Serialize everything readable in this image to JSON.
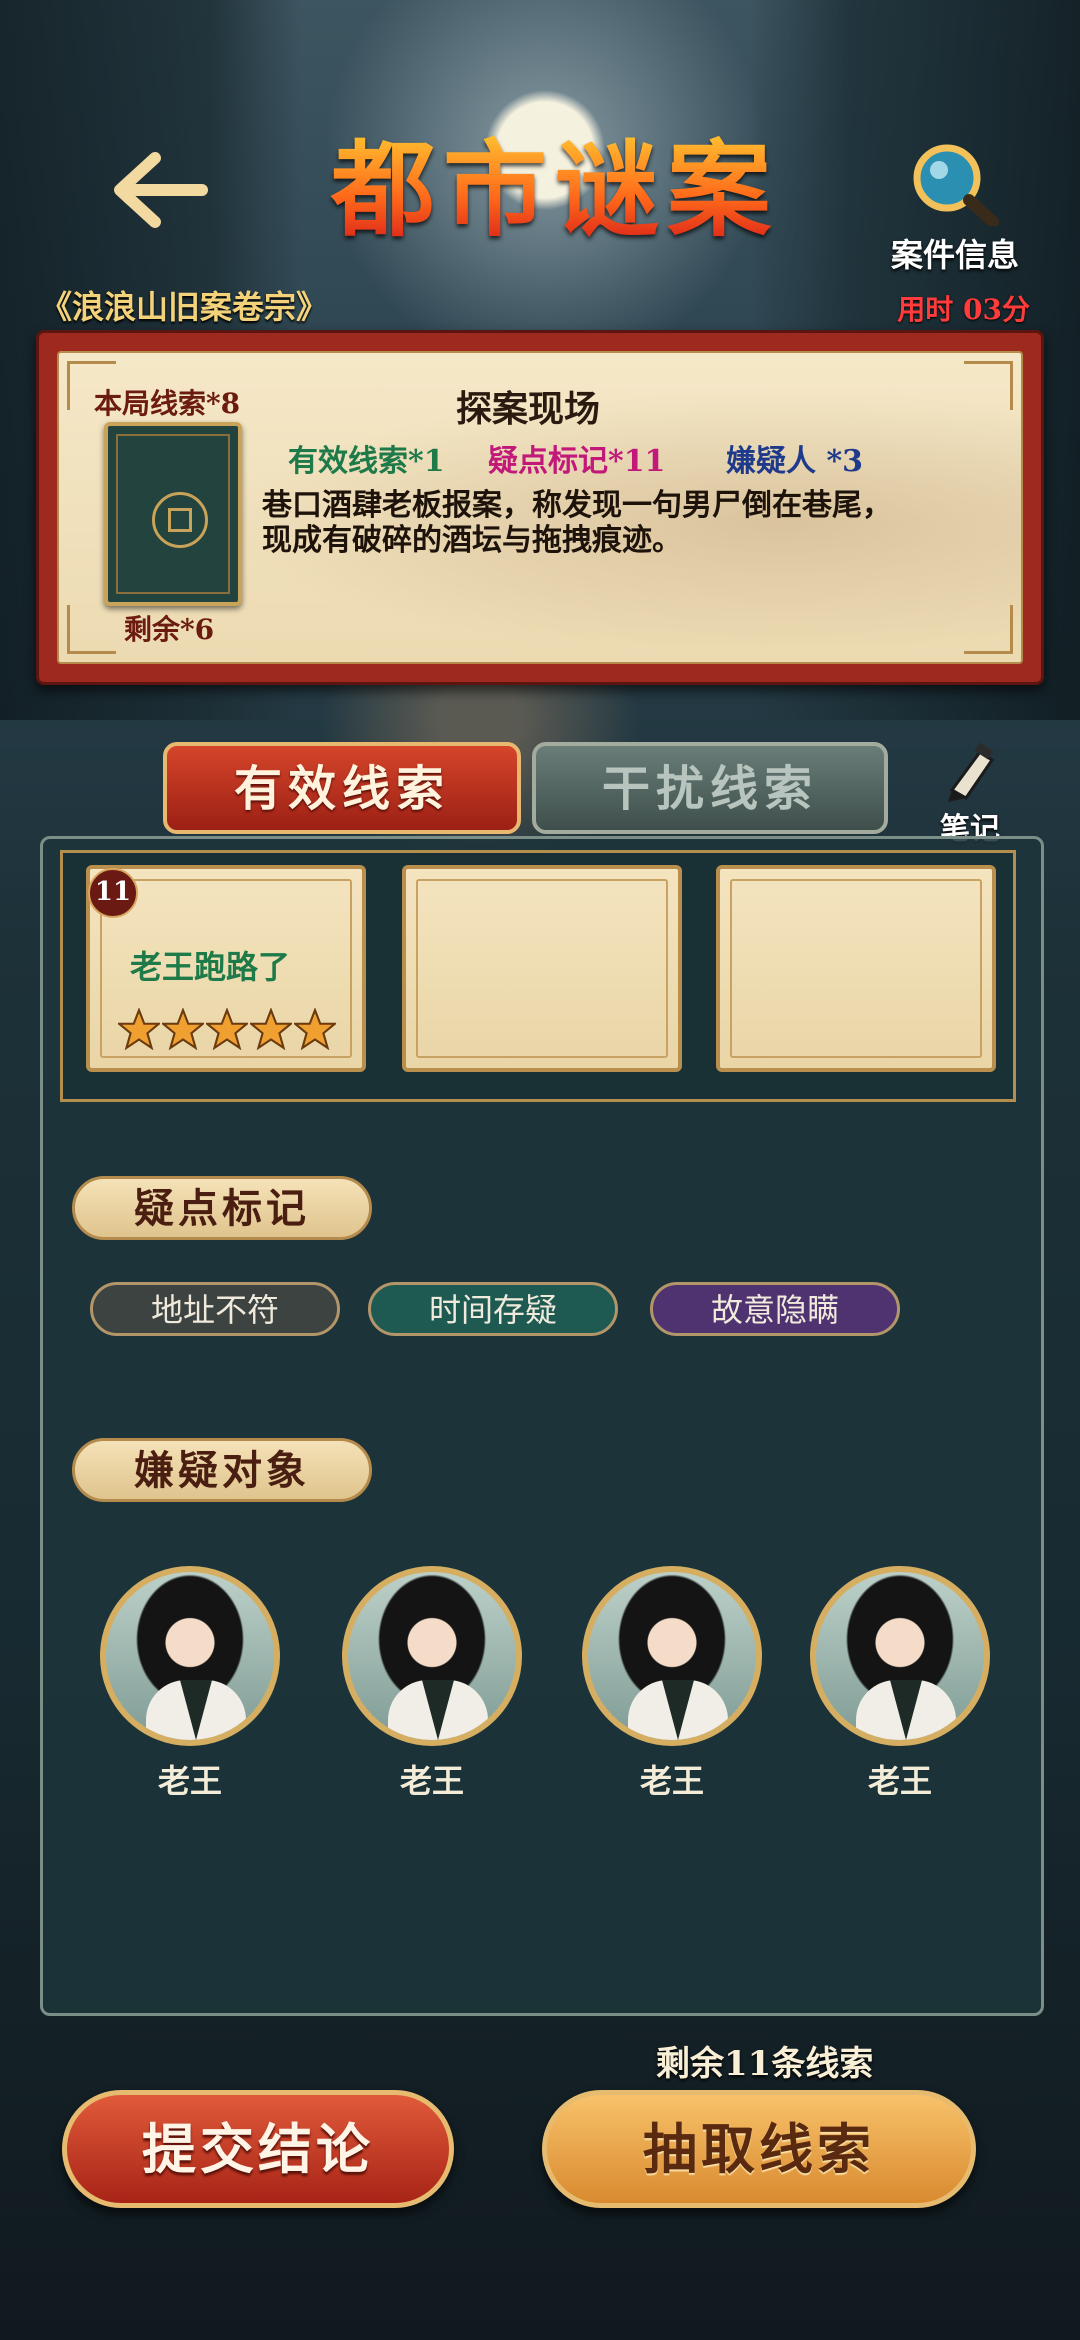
{
  "header": {
    "title": "都市谜案",
    "case_info_label": "案件信息",
    "case_name": "《浪浪山旧案卷宗》",
    "timer": "用时 03分"
  },
  "scene": {
    "title": "探案现场",
    "clue_count": "本局线索*8",
    "remaining": "剩余*6",
    "stats": {
      "valid": "有效线索*1",
      "doubt": "疑点标记*11",
      "suspects": "嫌疑人 *3"
    },
    "description": "巷口酒肆老板报案，称发现一句男尸倒在巷尾，现成有破碎的酒坛与拖拽痕迹。"
  },
  "tabs": {
    "active": "有效线索",
    "inactive": "干扰线索"
  },
  "notes_label": "笔记",
  "cards": [
    {
      "badge": "11",
      "text": "老王跑路了",
      "stars": 5
    },
    {
      "text": ""
    },
    {
      "text": ""
    }
  ],
  "doubt_section": {
    "label": "疑点标记",
    "tags": [
      "地址不符",
      "时间存疑",
      "故意隐瞒"
    ],
    "tag_colors": [
      "#3d4340",
      "#1e5a52",
      "#4f3270"
    ]
  },
  "suspect_section": {
    "label": "嫌疑对象",
    "suspects": [
      {
        "name": "老王"
      },
      {
        "name": "老王"
      },
      {
        "name": "老王"
      },
      {
        "name": "老王"
      }
    ]
  },
  "footer": {
    "remaining_clues": "剩余11条线索",
    "submit": "提交结论",
    "draw": "抽取线索"
  },
  "colors": {
    "accent_red": "#9e2a1f",
    "gold": "#d6ae62",
    "valid_green": "#1f7a4a",
    "doubt_pink": "#c2187a",
    "suspect_blue": "#1f3a8a"
  },
  "icons": [
    "back-arrow-icon",
    "magnifier-icon",
    "brush-notes-icon",
    "star-icon",
    "deck-emblem-icon"
  ]
}
